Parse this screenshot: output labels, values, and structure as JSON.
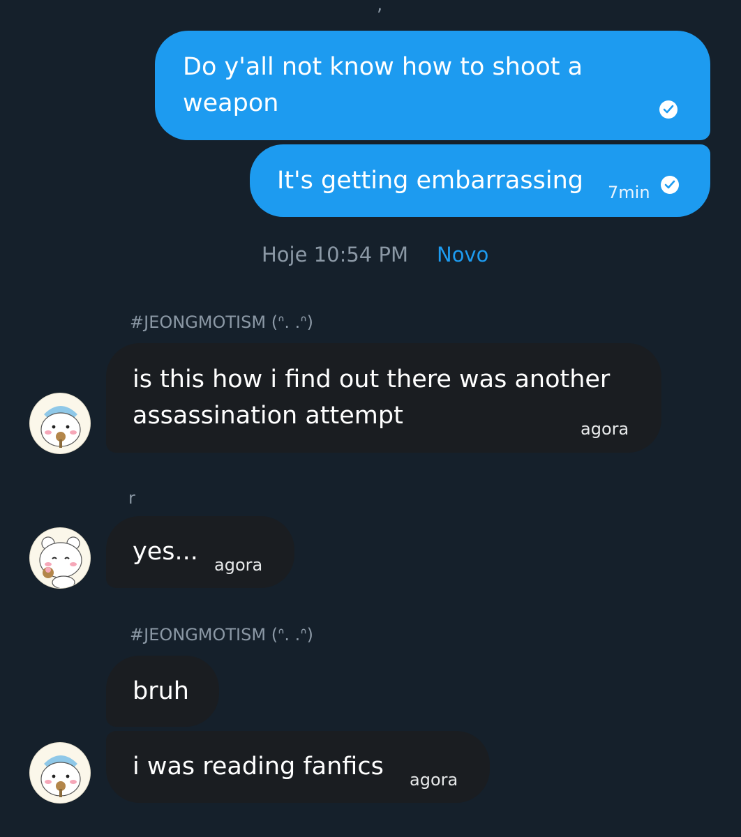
{
  "colors": {
    "background": "#15202b",
    "outgoing_bubble": "#1d9bf0",
    "incoming_bubble": "#1a1d21",
    "muted_text": "#8b98a5",
    "accent": "#1d9bf0"
  },
  "messages_out": [
    {
      "line1": "Do y'all not know how to shoot a",
      "line2": "weapon",
      "status_icon": "read-check-icon"
    },
    {
      "text": "It's getting embarrassing",
      "time": "7min",
      "status_icon": "read-check-icon"
    }
  ],
  "divider": {
    "timestamp": "Hoje 10:54 PM",
    "new_label": "Novo"
  },
  "messages_in": [
    {
      "sender": "#JEONGMOTISM (ᐢ. .ᐢ)",
      "line1": "is this how i find out there was another",
      "line2": "assassination attempt",
      "time": "agora",
      "avatar": "hachiware-avatar"
    },
    {
      "sender": "r",
      "text": "yes...",
      "time": "agora",
      "avatar": "chiikawa-avatar"
    },
    {
      "sender": "#JEONGMOTISM (ᐢ. .ᐢ)",
      "text": "bruh"
    },
    {
      "text": "i was reading fanfics",
      "time": "agora",
      "avatar": "hachiware-avatar"
    }
  ]
}
